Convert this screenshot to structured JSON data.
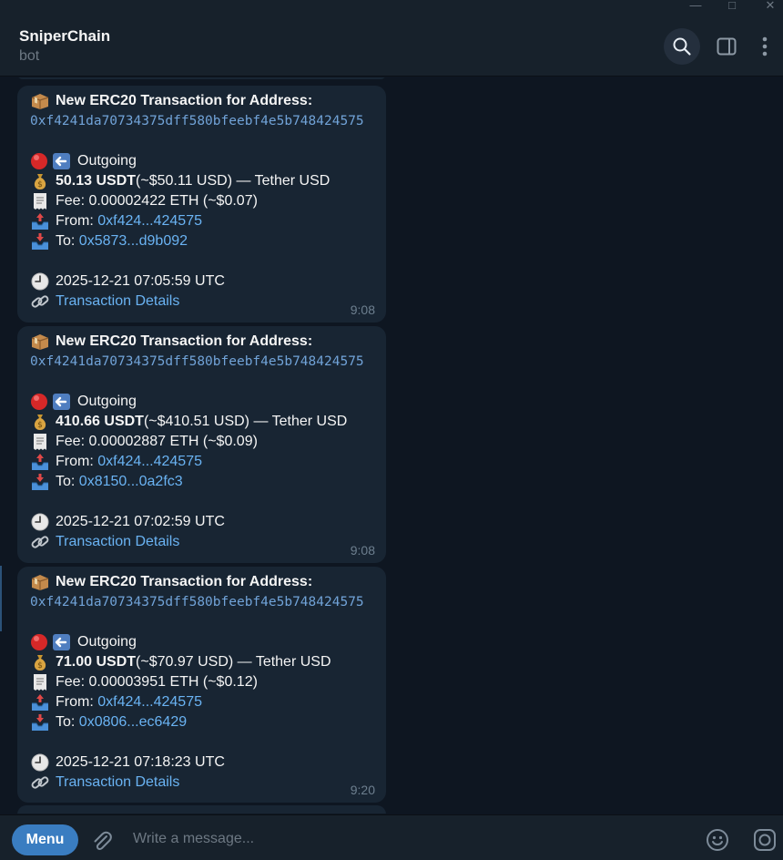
{
  "header": {
    "chat_name": "SniperChain",
    "chat_status": "bot"
  },
  "messages": [
    {
      "title": "New ERC20 Transaction for Address:",
      "address": "0xf4241da70734375dff580bfeebf4e5b748424575",
      "direction": "Outgoing",
      "amount": "50.13 USDT",
      "amount_rest": " (~$50.11 USD) — Tether USD",
      "fee": "Fee: 0.00002422 ETH (~$0.07)",
      "from_label": "From: ",
      "from_addr": "0xf424...424575",
      "to_label": "To: ",
      "to_addr": "0x5873...d9b092",
      "datetime": "2025-12-21 07:05:59 UTC",
      "details_link": "Transaction Details",
      "time": "9:08"
    },
    {
      "title": "New ERC20 Transaction for Address:",
      "address": "0xf4241da70734375dff580bfeebf4e5b748424575",
      "direction": "Outgoing",
      "amount": "410.66 USDT",
      "amount_rest": " (~$410.51 USD) — Tether USD",
      "fee": "Fee: 0.00002887 ETH (~$0.09)",
      "from_label": "From: ",
      "from_addr": "0xf424...424575",
      "to_label": "To: ",
      "to_addr": "0x8150...0a2fc3",
      "datetime": "2025-12-21 07:02:59 UTC",
      "details_link": "Transaction Details",
      "time": "9:08"
    },
    {
      "title": "New ERC20 Transaction for Address:",
      "address": "0xf4241da70734375dff580bfeebf4e5b748424575",
      "direction": "Outgoing",
      "amount": "71.00 USDT",
      "amount_rest": " (~$70.97 USD) — Tether USD",
      "fee": "Fee: 0.00003951 ETH (~$0.12)",
      "from_label": "From: ",
      "from_addr": "0xf424...424575",
      "to_label": "To: ",
      "to_addr": "0x0806...ec6429",
      "datetime": "2025-12-21 07:18:23 UTC",
      "details_link": "Transaction Details",
      "time": "9:20"
    }
  ],
  "composer": {
    "menu_label": "Menu",
    "placeholder": "Write a message..."
  },
  "icons": {
    "package": "package-icon",
    "red_circle": "red-circle-icon",
    "left_arrow": "left-arrow-icon",
    "money_bag": "money-bag-icon",
    "receipt": "receipt-icon",
    "outbox": "outbox-tray-icon",
    "inbox": "inbox-tray-icon",
    "clock": "clock-icon",
    "link": "link-icon"
  },
  "colors": {
    "background": "#0e1621",
    "bubble": "#182533",
    "link": "#6ab3f3",
    "menu_button": "#3a7dc1"
  }
}
